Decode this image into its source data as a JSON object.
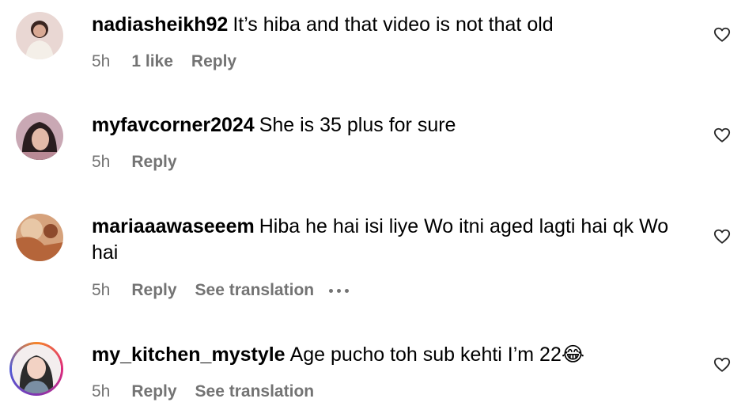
{
  "comments": [
    {
      "username": "nadiasheikh92",
      "text": "It’s hiba and that video is not that old",
      "time": "5h",
      "likes": "1 like",
      "reply": "Reply"
    },
    {
      "username": "myfavcorner2024",
      "text": "She is 35 plus for sure",
      "time": "5h",
      "reply": "Reply"
    },
    {
      "username": "mariaaawaseeem",
      "text": "Hiba he hai isi liye Wo itni aged lagti hai qk Wo hai",
      "time": "5h",
      "reply": "Reply",
      "translate": "See translation"
    },
    {
      "username": "my_kitchen_mystyle",
      "text": "Age pucho toh sub kehti I’m 22😂",
      "time": "5h",
      "reply": "Reply",
      "translate": "See translation"
    }
  ],
  "icons": {
    "like": "heart-outline-icon",
    "more": "more-options-icon"
  },
  "colors": {
    "text": "#000000",
    "meta": "#737373",
    "story_ring": [
      "#f58529",
      "#dd2a7b",
      "#8134af"
    ]
  }
}
